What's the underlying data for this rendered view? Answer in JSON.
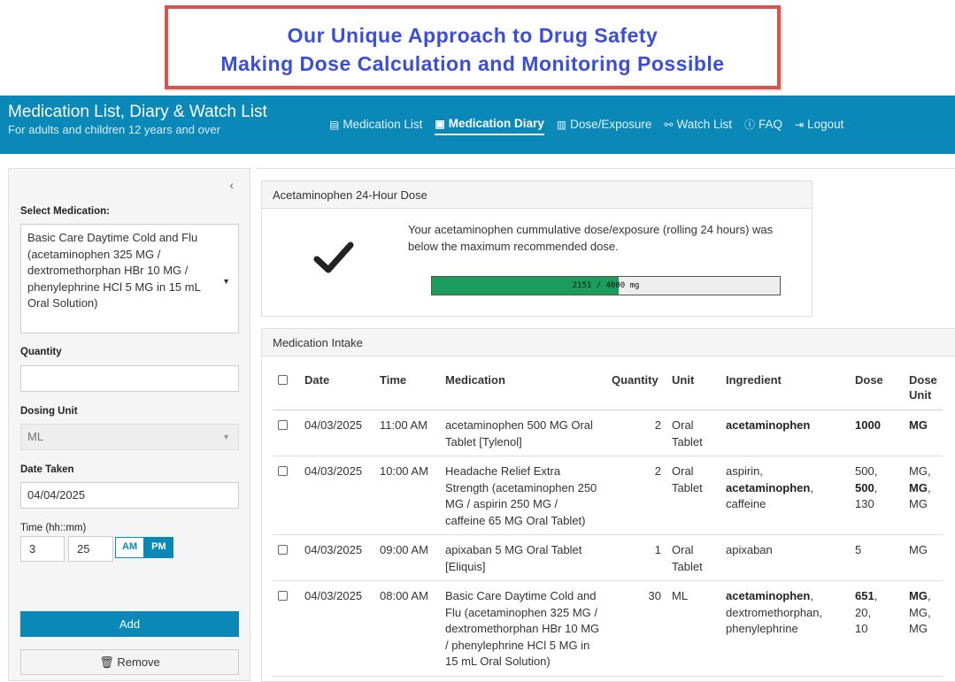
{
  "banner": {
    "line1": "Our Unique Approach to Drug Safety",
    "line2": "Making Dose Calculation and Monitoring Possible"
  },
  "header": {
    "title": "Medication List, Diary & Watch List",
    "subtitle": "For adults and children 12 years and over"
  },
  "nav": [
    {
      "label": "Medication List",
      "icon": "list-icon"
    },
    {
      "label": "Medication Diary",
      "icon": "diary-icon",
      "active": true
    },
    {
      "label": "Dose/Exposure",
      "icon": "dose-icon"
    },
    {
      "label": "Watch List",
      "icon": "watch-icon"
    },
    {
      "label": "FAQ",
      "icon": "help-icon"
    },
    {
      "label": "Logout",
      "icon": "logout-icon"
    }
  ],
  "sidebar": {
    "select_medication_label": "Select Medication:",
    "selected_medication": "Basic Care Daytime Cold and Flu (acetaminophen 325 MG / dextromethorphan HBr 10 MG / phenylephrine HCl 5 MG in 15 mL Oral Solution)",
    "quantity_label": "Quantity",
    "quantity_value": "",
    "dosing_unit_label": "Dosing Unit",
    "dosing_unit_value": "ML",
    "date_label": "Date Taken",
    "date_value": "04/04/2025",
    "time_label": "Time (hh::mm)",
    "hour": "3",
    "minute": "25",
    "am": "AM",
    "pm": "PM",
    "selected_period": "PM",
    "add_label": "Add",
    "remove_label": "Remove"
  },
  "dose_panel": {
    "title": "Acetaminophen 24-Hour Dose",
    "message": "Your acetaminophen cummulative dose/exposure (rolling 24 hours) was below the maximum recommended dose.",
    "current": 2151,
    "max": 4000,
    "progress_text": "2151 / 4000 mg",
    "colors": {
      "fill": "#1a9c5b"
    }
  },
  "intake": {
    "title": "Medication Intake",
    "columns": [
      "Date",
      "Time",
      "Medication",
      "Quantity",
      "Unit",
      "Ingredient",
      "Dose",
      "Dose Unit"
    ],
    "rows": [
      {
        "date": "04/03/2025",
        "time": "11:00 AM",
        "medication": "acetaminophen 500 MG Oral Tablet [Tylenol]",
        "quantity": "2",
        "unit": "Oral Tablet",
        "ingredients": [
          {
            "t": "acetaminophen",
            "b": true
          }
        ],
        "doses": [
          {
            "t": "1000",
            "b": true
          }
        ],
        "dose_units": [
          {
            "t": "MG",
            "b": true
          }
        ]
      },
      {
        "date": "04/03/2025",
        "time": "10:00 AM",
        "medication": "Headache Relief Extra Strength (acetaminophen 250 MG / aspirin 250 MG / caffeine 65 MG Oral Tablet)",
        "quantity": "2",
        "unit": "Oral Tablet",
        "ingredients": [
          {
            "t": "aspirin",
            "b": false
          },
          {
            "t": "acetaminophen",
            "b": true
          },
          {
            "t": "caffeine",
            "b": false
          }
        ],
        "doses": [
          {
            "t": "500",
            "b": false
          },
          {
            "t": "500",
            "b": true
          },
          {
            "t": "130",
            "b": false
          }
        ],
        "dose_units": [
          {
            "t": "MG",
            "b": false
          },
          {
            "t": "MG",
            "b": true
          },
          {
            "t": "MG",
            "b": false
          }
        ]
      },
      {
        "date": "04/03/2025",
        "time": "09:00 AM",
        "medication": "apixaban 5 MG Oral Tablet [Eliquis]",
        "quantity": "1",
        "unit": "Oral Tablet",
        "ingredients": [
          {
            "t": "apixaban",
            "b": false
          }
        ],
        "doses": [
          {
            "t": "5",
            "b": false
          }
        ],
        "dose_units": [
          {
            "t": "MG",
            "b": false
          }
        ]
      },
      {
        "date": "04/03/2025",
        "time": "08:00 AM",
        "medication": "Basic Care Daytime Cold and Flu (acetaminophen 325 MG / dextromethorphan HBr 10 MG / phenylephrine HCl 5 MG in 15 mL Oral Solution)",
        "quantity": "30",
        "unit": "ML",
        "ingredients": [
          {
            "t": "acetaminophen",
            "b": true
          },
          {
            "t": "dextromethorphan",
            "b": false
          },
          {
            "t": "phenylephrine",
            "b": false
          }
        ],
        "doses": [
          {
            "t": "651",
            "b": true
          },
          {
            "t": "20",
            "b": false
          },
          {
            "t": "10",
            "b": false
          }
        ],
        "dose_units": [
          {
            "t": "MG",
            "b": true
          },
          {
            "t": "MG",
            "b": false
          },
          {
            "t": "MG",
            "b": false
          }
        ]
      }
    ]
  }
}
